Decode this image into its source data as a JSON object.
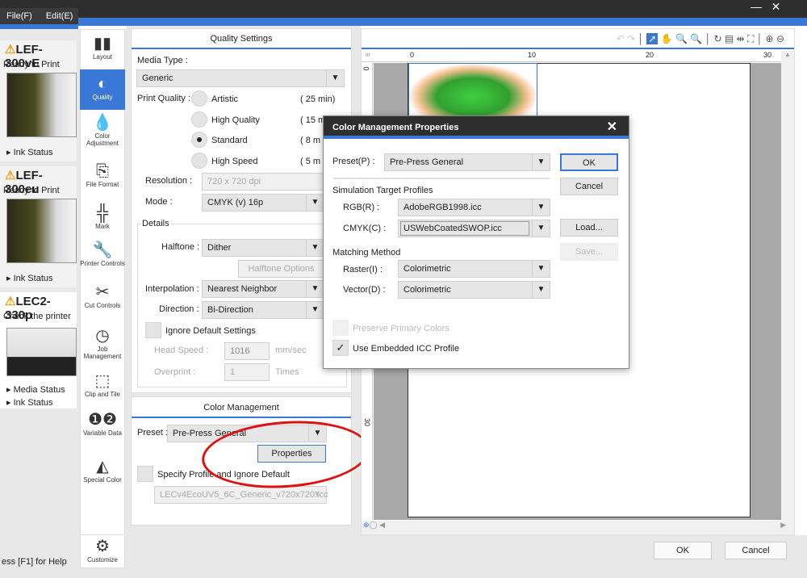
{
  "menu": {
    "file": "File(F)",
    "edit": "Edit(E)"
  },
  "printers": [
    {
      "name": "LEF-300vE",
      "status": "Ready to Print",
      "links": [
        "Ink Status"
      ]
    },
    {
      "name": "LEF-300eu",
      "status": "Ready to Print",
      "links": [
        "Ink Status"
      ]
    },
    {
      "name": "LEC2-330p",
      "status": "Check the printer",
      "links": [
        "Media Status",
        "Ink Status"
      ]
    }
  ],
  "help": "ess [F1] for Help",
  "nav": [
    {
      "label": "Layout",
      "icon": "layout-icon"
    },
    {
      "label": "Quality",
      "icon": "quality-icon",
      "selected": true
    },
    {
      "label": "Color Adjustment",
      "icon": "color-adjustment-icon"
    },
    {
      "label": "File Format",
      "icon": "file-format-icon"
    },
    {
      "label": "Mark",
      "icon": "mark-icon"
    },
    {
      "label": "Printer Controls",
      "icon": "wrench-icon"
    },
    {
      "label": "Cut Controls",
      "icon": "scissors-icon"
    },
    {
      "label": "Job Management",
      "icon": "clock-icon"
    },
    {
      "label": "Clip and Tile",
      "icon": "clip-icon"
    },
    {
      "label": "Variable Data",
      "icon": "variable-data-icon"
    },
    {
      "label": "Special Color",
      "icon": "swatch-icon"
    },
    {
      "label": "Customize",
      "icon": "gear-icon"
    }
  ],
  "quality": {
    "title": "Quality Settings",
    "media_type_label": "Media Type :",
    "media_type": "Generic",
    "print_quality_label": "Print Quality :",
    "options": [
      {
        "label": "Artistic",
        "time": "( 25 min)"
      },
      {
        "label": "High Quality",
        "time": "( 15 m"
      },
      {
        "label": "Standard",
        "time": "( 8 m",
        "selected": true
      },
      {
        "label": "High Speed",
        "time": "( 5 m"
      }
    ],
    "resolution_label": "Resolution :",
    "resolution": "720 x 720 dpi",
    "mode_label": "Mode :",
    "mode": "CMYK (v) 16p",
    "details": "Details",
    "halftone_label": "Halftone :",
    "halftone": "Dither",
    "halftone_options": "Halftone Options",
    "interpolation_label": "Interpolation :",
    "interpolation": "Nearest Neighbor",
    "direction_label": "Direction :",
    "direction": "Bi-Direction",
    "ignore_defaults": "Ignore Default Settings",
    "head_speed_label": "Head Speed :",
    "head_speed": "1016",
    "head_speed_unit": "mm/sec",
    "overprint_label": "Overprint :",
    "overprint": "1",
    "overprint_unit": "Times"
  },
  "color_mgmt": {
    "title": "Color Management",
    "preset_label": "Preset :",
    "preset": "Pre-Press General",
    "properties": "Properties",
    "specify_profile": "Specify Profile and Ignore Default",
    "profile": "LECv4EcoUV5_6C_Generic_v720x720.icc",
    "annotation_color": "#e01010"
  },
  "preview": {
    "ruler_unit": "in",
    "ruler_ticks": [
      "0",
      "10",
      "20",
      "30"
    ],
    "vruler_ticks": [
      "0",
      "30"
    ]
  },
  "footer": {
    "ok": "OK",
    "cancel": "Cancel"
  },
  "dialog": {
    "title": "Color Management Properties",
    "preset_label": "Preset(P) :",
    "preset": "Pre-Press General",
    "sim_title": "Simulation Target Profiles",
    "rgb_label": "RGB(R) :",
    "rgb": "AdobeRGB1998.icc",
    "cmyk_label": "CMYK(C) :",
    "cmyk": "USWebCoatedSWOP.icc",
    "matching_title": "Matching Method",
    "raster_label": "Raster(I) :",
    "raster": "Colorimetric",
    "vector_label": "Vector(D) :",
    "vector": "Colorimetric",
    "preserve": "Preserve Primary Colors",
    "use_embedded": "Use Embedded ICC Profile",
    "use_embedded_checked": true,
    "ok": "OK",
    "cancel": "Cancel",
    "load": "Load...",
    "save": "Save..."
  },
  "colors": {
    "accent": "#3a78d8",
    "titlebar": "#2e2e2e"
  }
}
